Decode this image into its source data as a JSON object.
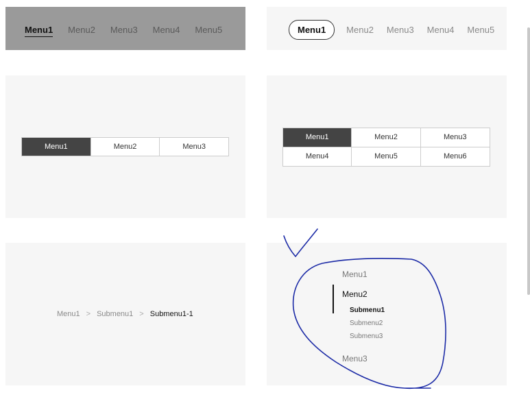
{
  "underline_menu": {
    "items": [
      "Menu1",
      "Menu2",
      "Menu3",
      "Menu4",
      "Menu5"
    ],
    "active_index": 0
  },
  "pill_menu": {
    "items": [
      "Menu1",
      "Menu2",
      "Menu3",
      "Menu4",
      "Menu5"
    ],
    "active_index": 0
  },
  "segmented_menu": {
    "items": [
      "Menu1",
      "Menu2",
      "Menu3"
    ],
    "active_index": 0
  },
  "grid_menu": {
    "items": [
      "Menu1",
      "Menu2",
      "Menu3",
      "Menu4",
      "Menu5",
      "Menu6"
    ],
    "active_index": 0
  },
  "breadcrumb": {
    "items": [
      "Menu1",
      "Submenu1",
      "Submenu1-1"
    ],
    "separator": ">"
  },
  "vertical_menu": {
    "items": [
      "Menu1",
      "Menu2",
      "Menu3"
    ],
    "active_index": 1,
    "submenu": [
      "Submenu1",
      "Submenu2",
      "Submenu3"
    ],
    "active_submenu_index": 0
  },
  "colors": {
    "active_fill": "#444444",
    "panel_bg": "#f6f6f6",
    "dark_panel_bg": "#9a9a9a",
    "annotation_stroke": "#1b2aa6"
  }
}
